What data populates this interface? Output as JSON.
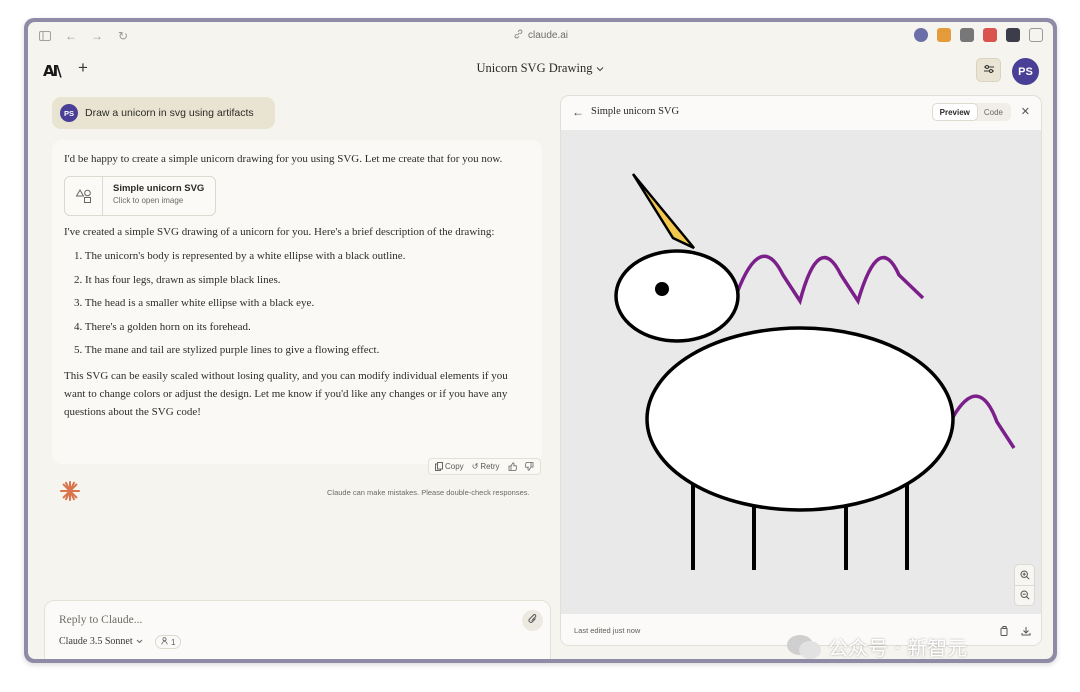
{
  "browser": {
    "url": "claude.ai",
    "extension_icons": [
      "download-icon",
      "fox-extension-icon",
      "book-extension-icon",
      "boat-extension-icon",
      "dark-extension-icon",
      "sidebar-toggle-icon"
    ]
  },
  "header": {
    "logo_text": "AI\\",
    "new_chat_label": "+",
    "conversation_title": "Unicorn SVG Drawing",
    "user_initials": "PS"
  },
  "chat": {
    "user_message": {
      "initials": "PS",
      "text": "Draw a unicorn in svg using artifacts"
    },
    "assistant": {
      "intro": "I'd be happy to create a simple unicorn drawing for you using SVG. Let me create that for you now.",
      "artifact": {
        "title": "Simple unicorn SVG",
        "subtitle": "Click to open image"
      },
      "description_intro": "I've created a simple SVG drawing of a unicorn for you. Here's a brief description of the drawing:",
      "items": [
        "1. The unicorn's body is represented by a white ellipse with a black outline.",
        "2. It has four legs, drawn as simple black lines.",
        "3. The head is a smaller white ellipse with a black eye.",
        "4. There's a golden horn on its forehead.",
        "5. The mane and tail are stylized purple lines to give a flowing effect."
      ],
      "outro": "This SVG can be easily scaled without losing quality, and you can modify individual elements if you want to change colors or adjust the design. Let me know if you'd like any changes or if you have any questions about the SVG code!",
      "actions": {
        "copy": "Copy",
        "retry": "Retry"
      }
    },
    "disclaimer": "Claude can make mistakes. Please double-check responses."
  },
  "input": {
    "placeholder": "Reply to Claude...",
    "model": "Claude 3.5 Sonnet",
    "attachment_count": "1"
  },
  "artifact_panel": {
    "title": "Simple unicorn SVG",
    "tabs": [
      {
        "label": "Preview",
        "active": true
      },
      {
        "label": "Code",
        "active": false
      }
    ],
    "last_edited": "Last edited just now",
    "colors": {
      "horn": "#f2c94c",
      "mane": "#7b1f8a",
      "outline": "#000000",
      "canvas": "#e9e9e9"
    }
  },
  "watermark": {
    "text": "公众号 · 新智元"
  }
}
